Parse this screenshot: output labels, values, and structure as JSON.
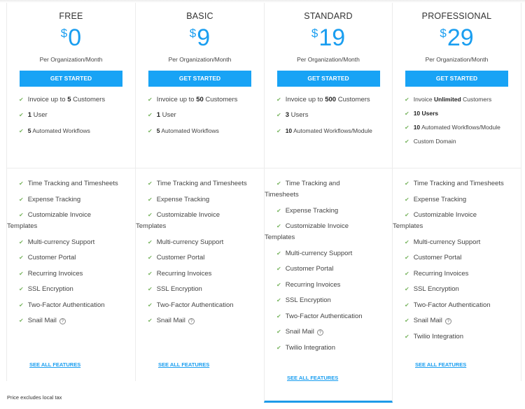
{
  "plans": [
    {
      "name": "FREE",
      "currency": "$",
      "price": "0",
      "period": "Per Organization/Month",
      "cta": "GET STARTED",
      "limits": [
        {
          "pre": "Invoice up to ",
          "bold": "5",
          "post": " Customers"
        },
        {
          "pre": "",
          "bold": "1",
          "post": " User"
        },
        {
          "pre": "",
          "bold": "5",
          "post": " Automated Workflows"
        }
      ],
      "features": [
        "Time Tracking and Timesheets",
        "Expense Tracking",
        "Customizable Invoice",
        "Multi-currency Support",
        "Customer Portal",
        "Recurring Invoices",
        "SSL Encryption",
        "Two-Factor Authentication",
        "Snail Mail"
      ],
      "feature_wraps": {
        "2": "Templates"
      },
      "see_all": "SEE ALL FEATURES"
    },
    {
      "name": "BASIC",
      "currency": "$",
      "price": "9",
      "period": "Per Organization/Month",
      "cta": "GET STARTED",
      "limits": [
        {
          "pre": "Invoice up to ",
          "bold": "50",
          "post": " Customers"
        },
        {
          "pre": "",
          "bold": "1",
          "post": " User"
        },
        {
          "pre": "",
          "bold": "5",
          "post": " Automated Workflows"
        }
      ],
      "features": [
        "Time Tracking and Timesheets",
        "Expense Tracking",
        "Customizable Invoice",
        "Multi-currency Support",
        "Customer Portal",
        "Recurring Invoices",
        "SSL Encryption",
        "Two-Factor Authentication",
        "Snail Mail"
      ],
      "feature_wraps": {
        "2": "Templates"
      },
      "see_all": "SEE ALL FEATURES"
    },
    {
      "name": "STANDARD",
      "currency": "$",
      "price": "19",
      "period": "Per Organization/Month",
      "cta": "GET STARTED",
      "highlighted": true,
      "limits": [
        {
          "pre": "Invoice up to ",
          "bold": "500",
          "post": " Customers"
        },
        {
          "pre": "",
          "bold": "3",
          "post": " Users"
        },
        {
          "pre": "",
          "bold": "10",
          "post": " Automated Workflows/Module"
        }
      ],
      "features": [
        "Time Tracking and",
        "Expense Tracking",
        "Customizable Invoice",
        "Multi-currency Support",
        "Customer Portal",
        "Recurring Invoices",
        "SSL Encryption",
        "Two-Factor Authentication",
        "Snail Mail",
        "Twilio Integration"
      ],
      "feature_wraps": {
        "0": "Timesheets",
        "2": "Templates"
      },
      "see_all": "SEE ALL FEATURES"
    },
    {
      "name": "PROFESSIONAL",
      "currency": "$",
      "price": "29",
      "period": "Per Organization/Month",
      "cta": "GET STARTED",
      "limits": [
        {
          "pre": "Invoice ",
          "bold": "Unlimited",
          "post": " Customers"
        },
        {
          "pre": "",
          "bold": "10 Users",
          "post": ""
        },
        {
          "pre": "",
          "bold": "10",
          "post": " Automated Workflows/Module"
        },
        {
          "pre": "Custom Domain",
          "bold": "",
          "post": ""
        }
      ],
      "features": [
        "Time Tracking and Timesheets",
        "Expense Tracking",
        "Customizable Invoice",
        "Multi-currency Support",
        "Customer Portal",
        "Recurring Invoices",
        "SSL Encryption",
        "Two-Factor Authentication",
        "Snail Mail",
        "Twilio Integration"
      ],
      "feature_wraps": {
        "2": "Templates"
      },
      "see_all": "SEE ALL FEATURES"
    }
  ],
  "icons": {
    "check": "✔",
    "help": "?"
  },
  "colors": {
    "accent": "#18a3f5",
    "check": "#7bb662",
    "highlight_border": "#1e9be9"
  },
  "footer": {
    "tax_note": "Price excludes local tax"
  }
}
